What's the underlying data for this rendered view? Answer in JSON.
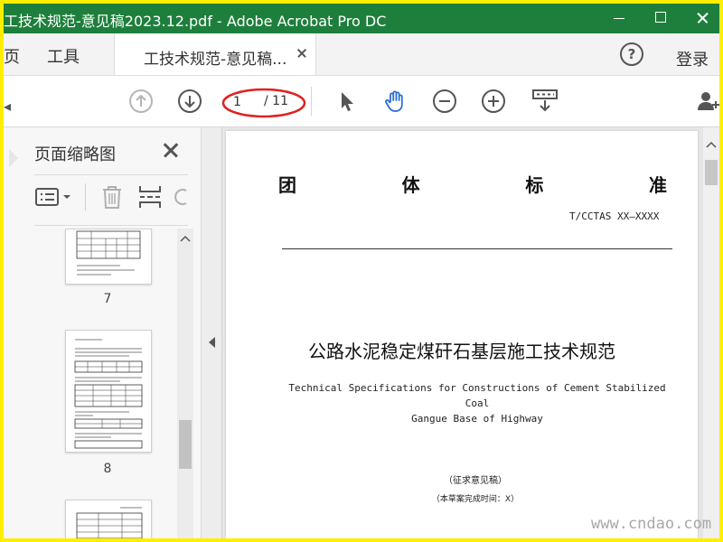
{
  "window": {
    "title": "工技术规范-意见稿2023.12.pdf - Adobe Acrobat Pro DC"
  },
  "menubar": {
    "home_label": "页",
    "tools_label": "工具",
    "document_tab_label": "工技术规范-意见稿...",
    "login_label": "登录",
    "help_glyph": "?"
  },
  "toolbar": {
    "current_page": "1",
    "total_pages": "/ 11",
    "left_fragment": "◂"
  },
  "sidebar": {
    "title": "页面缩略图",
    "thumbnails": [
      {
        "label": "7"
      },
      {
        "label": "8"
      },
      {
        "label": ""
      }
    ]
  },
  "document": {
    "heading_chars": [
      "团",
      "体",
      "标",
      "准"
    ],
    "standard_code": "T/CCTAS XX—XXXX",
    "title_cn": "公路水泥稳定煤矸石基层施工技术规范",
    "title_en_line1": "Technical Specifications for Constructions of Cement Stabilized Coal",
    "title_en_line2": "Gangue Base of Highway",
    "draft_label": "（征求意见稿）",
    "draft_date": "（本草案完成时间：X）"
  },
  "watermark": "www.cndao.com",
  "colors": {
    "titlebar": "#1e7f3c",
    "border": "#ffee00",
    "annotation": "#e02020",
    "hand_tool": "#2c6fd6"
  }
}
